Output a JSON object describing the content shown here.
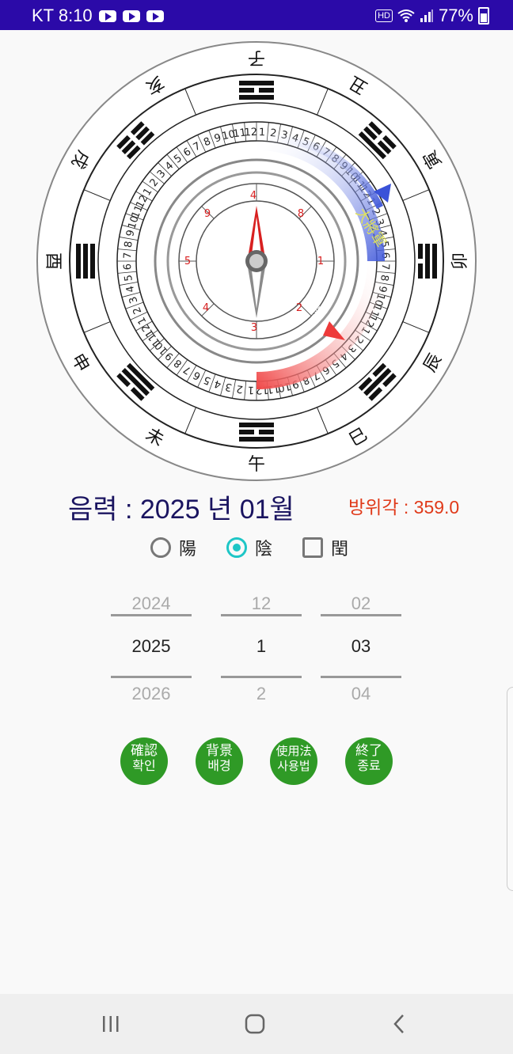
{
  "status_bar": {
    "carrier_time": "KT 8:10",
    "hd": "HD",
    "battery": "77%"
  },
  "compass": {
    "outer_branches": [
      "子",
      "丑",
      "寅",
      "卯",
      "辰",
      "巳",
      "午",
      "未",
      "申",
      "酉",
      "戌",
      "亥"
    ],
    "arrow_blue_label": "大將軍",
    "arrow_red_label": "三殺",
    "inner_numbers_red": [
      "4",
      "9",
      "5",
      "1",
      "8",
      "2",
      "3"
    ],
    "ring_numbers": [
      "1",
      "2",
      "3",
      "4",
      "5",
      "6",
      "7",
      "8",
      "9",
      "10",
      "11",
      "12"
    ]
  },
  "lunar": {
    "title": "음력 : 2025 년 01월",
    "azimuth": "방위각 : 359.0"
  },
  "options": {
    "yang": "陽",
    "yin": "陰",
    "leap": "閏",
    "selected": "yin"
  },
  "pickers": {
    "year": {
      "prev": "2024",
      "value": "2025",
      "next": "2026"
    },
    "month": {
      "prev": "12",
      "value": "1",
      "next": "2"
    },
    "day": {
      "prev": "02",
      "value": "03",
      "next": "04"
    }
  },
  "buttons": {
    "confirm": {
      "l1": "確認",
      "l2": "확인"
    },
    "background": {
      "l1": "背景",
      "l2": "배경"
    },
    "usage": {
      "l1": "使用法",
      "l2": "사용법"
    },
    "exit": {
      "l1": "終了",
      "l2": "종료"
    }
  },
  "colors": {
    "status_bar": "#2b0aa8",
    "button_green": "#2f9a26",
    "title_navy": "#1a1460",
    "accent_red": "#e03a1a",
    "radio_teal": "#1ec6c6"
  }
}
